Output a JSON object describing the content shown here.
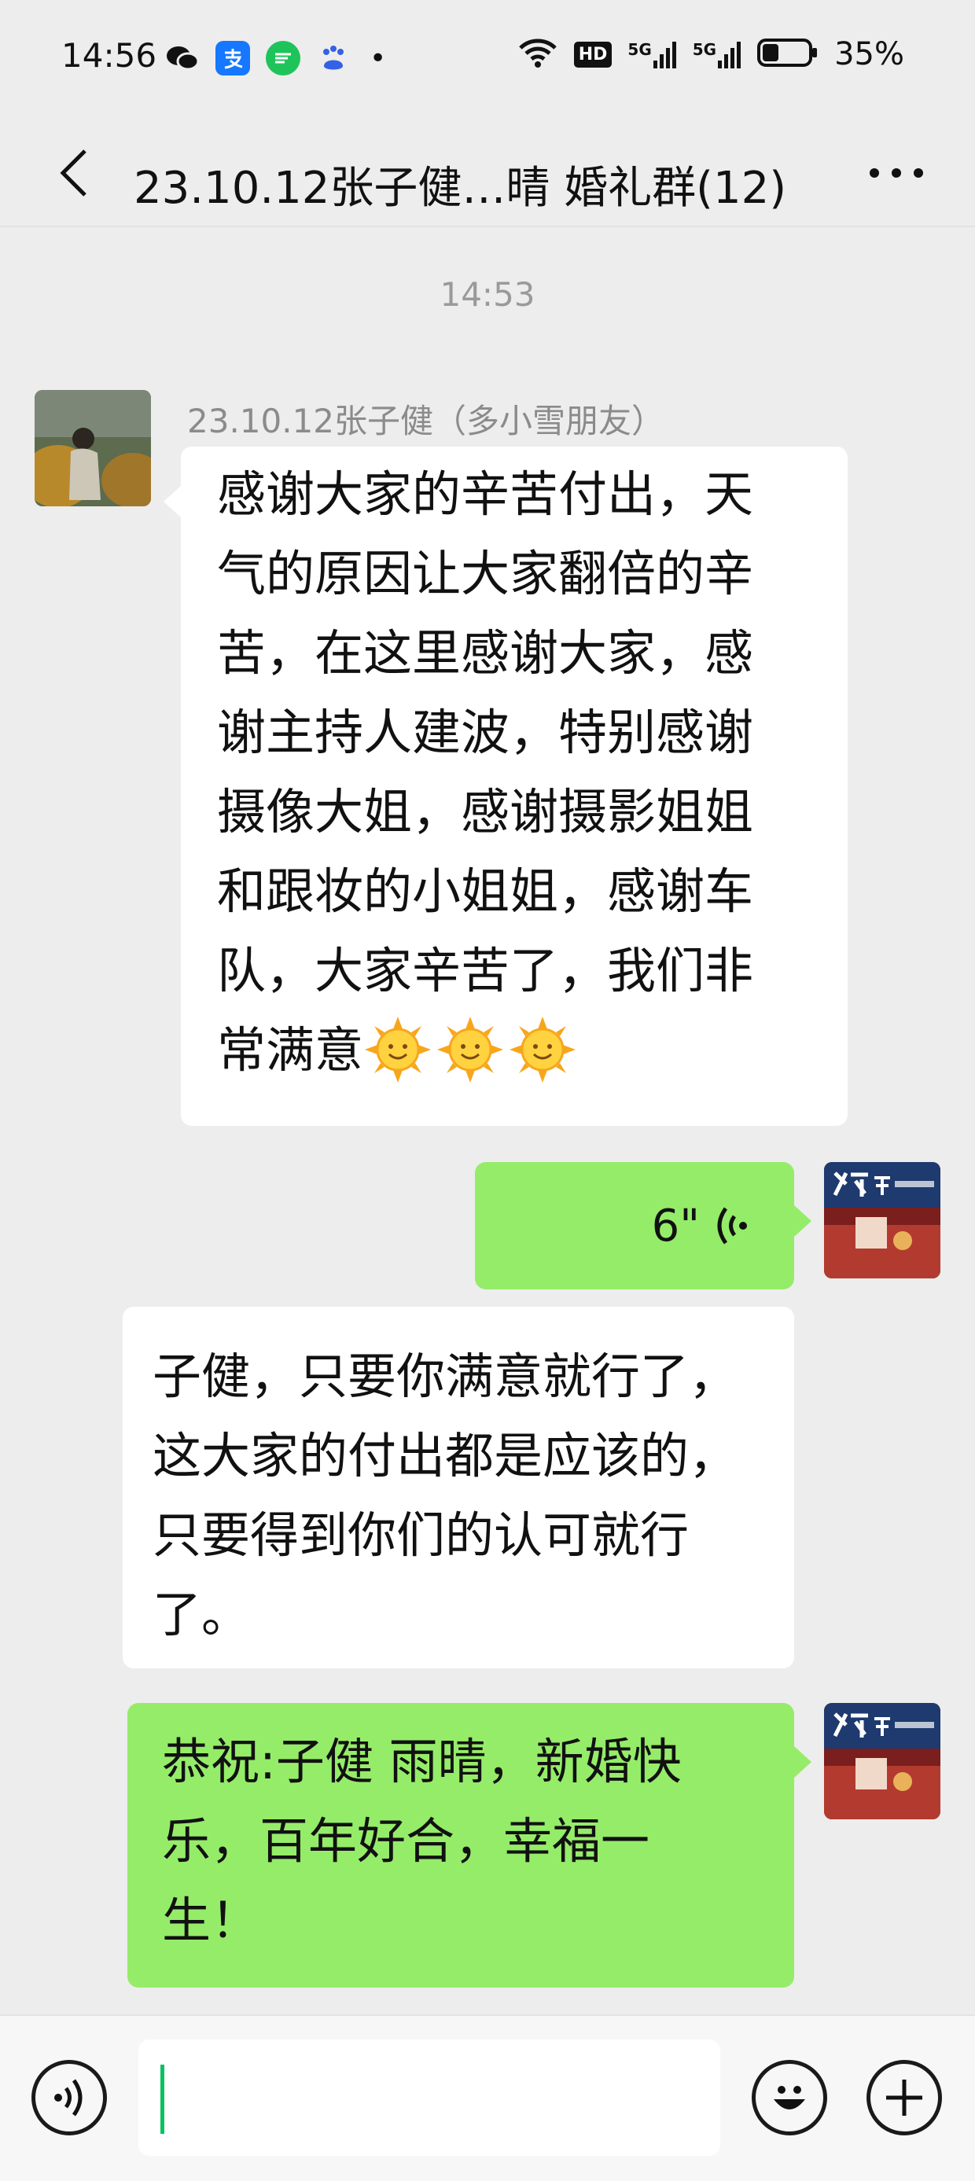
{
  "status_bar": {
    "time": "14:56",
    "apps": [
      "wechat-icon",
      "alipay-icon",
      "message-app-icon",
      "baidu-icon"
    ],
    "dot": "•",
    "hd_label": "HD",
    "network_a": "5G",
    "network_b": "5G",
    "battery_percent": "35%",
    "battery_level": 0.35
  },
  "nav": {
    "title": "23.10.12张子健…晴 婚礼群(12)"
  },
  "chat": {
    "timestamp": "14:53",
    "messages": [
      {
        "sender": "23.10.12张子健（多小雪朋友）",
        "lines": [
          "感谢大家的辛苦付出，天",
          "气的原因让大家翻倍的辛",
          "苦，在这里感谢大家，感",
          "谢主持人建波，特别感谢",
          "摄像大姐，感谢摄影姐姐",
          "和跟妆的小姐姐，感谢车",
          "队，大家辛苦了，我们非",
          "常满意"
        ],
        "emoji": [
          "sun-face-icon",
          "sun-face-icon",
          "sun-face-icon"
        ]
      },
      {
        "voice_duration": "6\""
      },
      {
        "lines": [
          "子健，只要你满意就行了，",
          "这大家的付出都是应该的，",
          "只要得到你们的认可就行",
          "了。"
        ]
      },
      {
        "lines": [
          "恭祝:子健 雨晴，新婚快",
          "乐，百年好合，幸福一",
          "生！"
        ]
      }
    ]
  },
  "colors": {
    "background": "#ededed",
    "bubble_green": "#95ec69",
    "bubble_white": "#ffffff",
    "cursor": "#07c160"
  }
}
